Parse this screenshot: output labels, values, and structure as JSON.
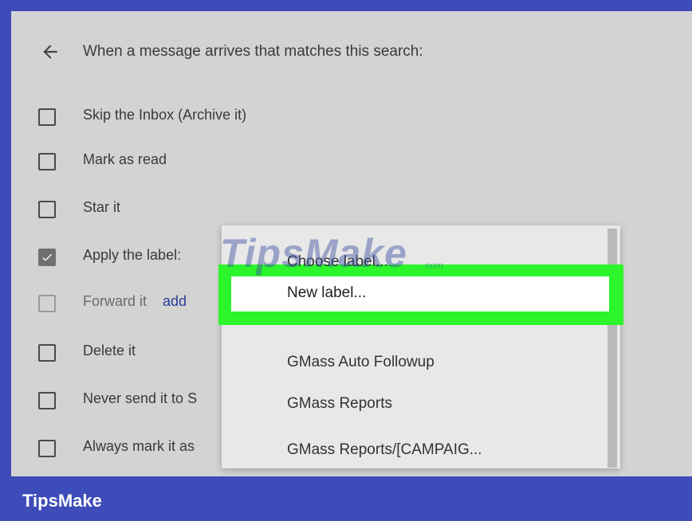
{
  "header": {
    "text": "When a message arrives that matches this search:"
  },
  "options": [
    {
      "label": "Skip the Inbox (Archive it)",
      "checked": false,
      "disabled": false
    },
    {
      "label": "Mark as read",
      "checked": false,
      "disabled": false
    },
    {
      "label": "Star it",
      "checked": false,
      "disabled": false
    },
    {
      "label": "Apply the label:",
      "checked": true,
      "disabled": false
    },
    {
      "label": "Forward it",
      "link": "add",
      "checked": false,
      "disabled": true
    },
    {
      "label": "Delete it",
      "checked": false,
      "disabled": false
    },
    {
      "label": "Never send it to S",
      "checked": false,
      "disabled": false
    },
    {
      "label": "Always mark it as",
      "checked": false,
      "disabled": false
    }
  ],
  "dropdown": {
    "items": [
      "Choose label...",
      "New label...",
      "GMass Auto Followup",
      "GMass Reports",
      "GMass Reports/[CAMPAIG..."
    ]
  },
  "watermark": {
    "text": "TipsMake",
    "suffix": ".com"
  },
  "footer": {
    "brand": "TipsMake"
  },
  "colors": {
    "highlight": "#2cf52c",
    "brand_bar": "#3d4cb8",
    "panel": "#d3d3d3"
  }
}
